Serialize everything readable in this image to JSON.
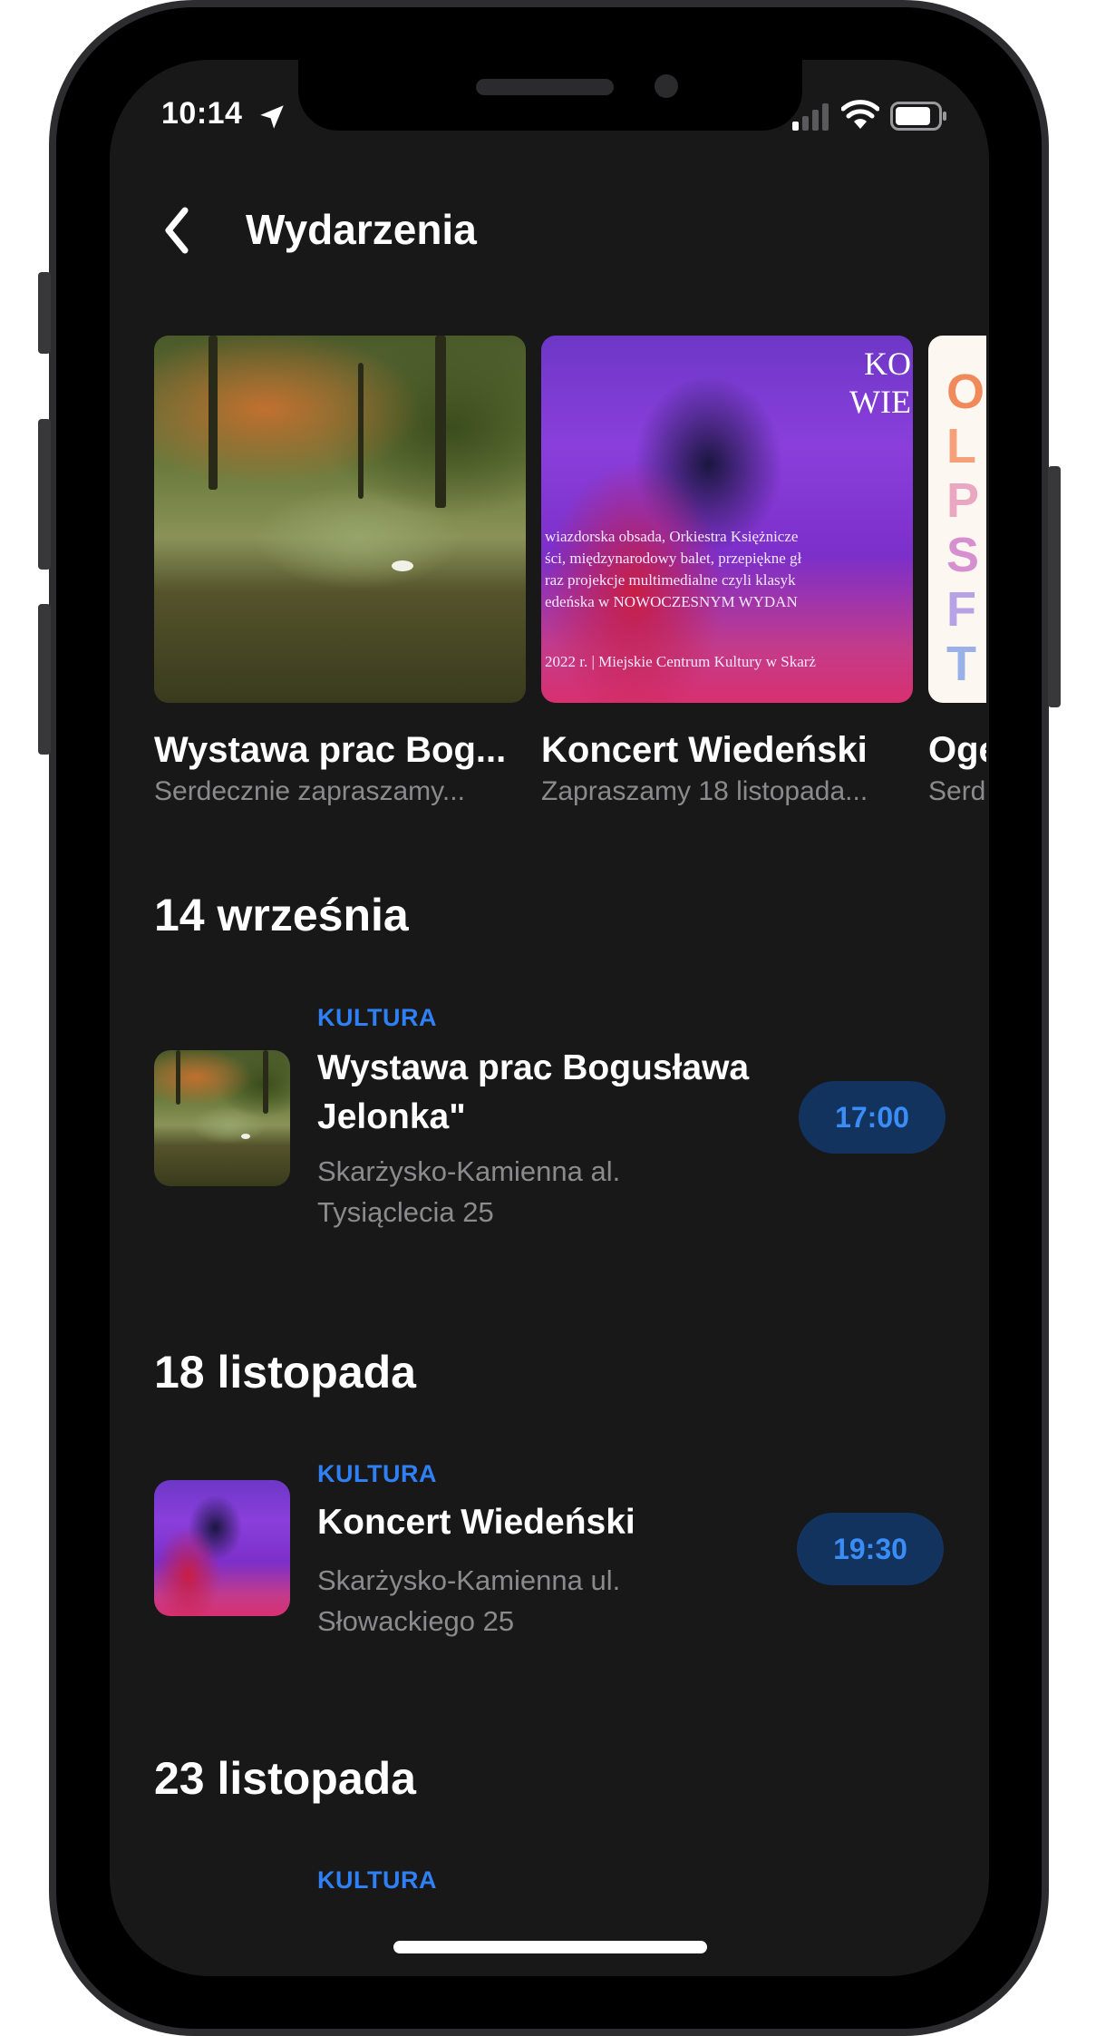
{
  "status_bar": {
    "time": "10:14"
  },
  "header": {
    "title": "Wydarzenia"
  },
  "carousel": [
    {
      "title": "Wystawa prac Bog...",
      "subtitle": "Serdecznie zapraszamy..."
    },
    {
      "title": "Koncert Wiedeński",
      "subtitle": "Zapraszamy 18 listopada...",
      "image_text": {
        "big1": "KO",
        "big2": "WIE",
        "line1": "wiazdorska obsada, Orkiestra Księżnicze",
        "line2": "ści, międzynarodowy balet, przepiękne gł",
        "line3": "raz projekcje multimedialne czyli klasyk",
        "line4": "edeńska w NOWOCZESNYM WYDAN",
        "line5": "2022 r. | Miejskie Centrum Kultury w Skarż"
      }
    },
    {
      "title": "Oge",
      "subtitle": "Serd",
      "poster_letters": [
        "O",
        "L",
        "P",
        "S",
        "F",
        "T"
      ]
    }
  ],
  "sections": [
    {
      "date": "14 września",
      "events": [
        {
          "category": "KULTURA",
          "title": "Wystawa prac Bogusława Jelonka\"",
          "address": "Skarżysko-Kamienna al. Tysiąclecia 25",
          "time": "17:00"
        }
      ]
    },
    {
      "date": "18 listopada",
      "events": [
        {
          "category": "KULTURA",
          "title": "Koncert Wiedeński",
          "address": "Skarżysko-Kamienna ul. Słowackiego 25",
          "time": "19:30"
        }
      ]
    },
    {
      "date": "23 listopada",
      "events": [
        {
          "category": "KULTURA"
        }
      ]
    }
  ],
  "colors": {
    "background": "#181818",
    "accent": "#2f7ff5",
    "pill_bg": "#13335f",
    "muted_text": "#8b8b8e"
  },
  "icons": {
    "back": "chevron-left-icon",
    "location": "location-arrow-icon",
    "signal": "cellular-signal-icon",
    "wifi": "wifi-icon",
    "battery": "battery-icon"
  }
}
